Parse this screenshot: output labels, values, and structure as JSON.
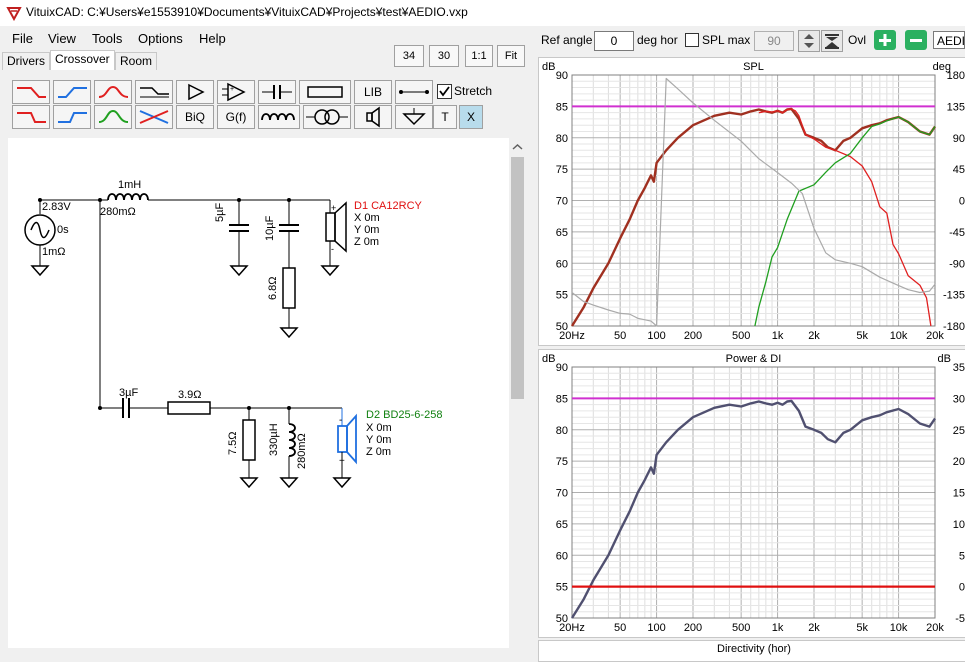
{
  "window": {
    "title": "VituixCAD: C:¥Users¥e1553910¥Documents¥VituixCAD¥Projects¥test¥AEDIO.vxp"
  },
  "menu": [
    "File",
    "View",
    "Tools",
    "Options",
    "Help"
  ],
  "tabs": [
    "Drivers",
    "Crossover",
    "Room"
  ],
  "zoom": {
    "w": "34",
    "h": "30",
    "one_to_one": "1:1",
    "fit": "Fit"
  },
  "tools": {
    "lib": "LIB",
    "biq": "BiQ",
    "gf": "G(f)",
    "stretch": "Stretch",
    "t": "T",
    "x": "X",
    "stretch_checked": true
  },
  "right_toolbar": {
    "ref_angle_label": "Ref angle",
    "ref_angle_value": "0",
    "deg_hor": "deg hor",
    "spl_max_label": "SPL max",
    "spl_max_value": "90",
    "ovl": "Ovl",
    "overlay_name": "AEDIO"
  },
  "schematic": {
    "source": {
      "voltage": "2.83V",
      "delay": "0s",
      "impedance": "1mΩ"
    },
    "l1": {
      "value": "1mH",
      "dcr": "280mΩ"
    },
    "c1": "5µF",
    "c2": "10µF",
    "r1": "6.8Ω",
    "c3": "3µF",
    "r2": "3.9Ω",
    "r3": "7.5Ω",
    "l2": {
      "value": "330µH",
      "dcr": "280mΩ"
    },
    "d1": {
      "name": "D1 CA12RCY",
      "x": "X 0m",
      "y": "Y 0m",
      "z": "Z 0m",
      "color": "#e01010"
    },
    "d2": {
      "name": "D2 BD25-6-258",
      "x": "X 0m",
      "y": "Y 0m",
      "z": "Z 0m",
      "color": "#108010"
    }
  },
  "spl_graph": {
    "title": "SPL",
    "left_unit": "dB",
    "right_unit": "deg",
    "y_ticks": [
      "90",
      "85",
      "80",
      "75",
      "70",
      "65",
      "60",
      "55",
      "50"
    ],
    "right_ticks": [
      "180",
      "135",
      "90",
      "45",
      "0",
      "-45",
      "-90",
      "-135",
      "-180"
    ],
    "x_ticks": [
      "20Hz",
      "50",
      "100",
      "200",
      "500",
      "1k",
      "2k",
      "5k",
      "10k",
      "20k"
    ]
  },
  "power_graph": {
    "title": "Power & DI",
    "left_unit": "dB",
    "right_unit": "dB",
    "y_ticks": [
      "90",
      "85",
      "80",
      "75",
      "70",
      "65",
      "60",
      "55",
      "50"
    ],
    "right_ticks": [
      "35",
      "30",
      "25",
      "20",
      "15",
      "10",
      "5",
      "0",
      "-5"
    ],
    "x_ticks": [
      "20Hz",
      "50",
      "100",
      "200",
      "500",
      "1k",
      "2k",
      "5k",
      "10k",
      "20k"
    ]
  },
  "bottom_graph_title": "Directivity (hor)",
  "chart_data": [
    {
      "type": "line",
      "title": "SPL",
      "x_scale": "log",
      "xlim": [
        20,
        20000
      ],
      "ylim": [
        50,
        90
      ],
      "y2lim": [
        -180,
        180
      ],
      "grid": true,
      "reference_line": 85,
      "series": [
        {
          "color": "#a03020",
          "x": [
            20,
            25,
            30,
            40,
            50,
            60,
            70,
            80,
            90,
            95,
            100,
            120,
            150,
            200,
            300,
            400,
            500,
            600,
            700,
            800,
            900,
            1000,
            1100,
            1200,
            1300,
            1500,
            1700,
            2000,
            2300,
            2600,
            3000,
            3500,
            4000,
            5000,
            6000,
            7000,
            8000,
            10000,
            12000,
            15000,
            18000,
            20000
          ],
          "y": [
            50,
            53,
            56,
            60,
            64,
            67,
            70,
            72,
            74,
            73,
            76,
            78,
            80,
            82,
            83.5,
            84,
            83.7,
            84.2,
            84.5,
            84.2,
            84,
            84.3,
            84,
            84.5,
            84.6,
            83,
            80.5,
            80,
            79.5,
            78.5,
            78,
            79.5,
            80,
            81.5,
            82,
            82.3,
            82.8,
            83.3,
            82.5,
            81,
            80.5,
            81.8
          ]
        },
        {
          "color": "#e02020",
          "x": [
            700,
            800,
            900,
            1000,
            1100,
            1200,
            1300,
            1400,
            1500,
            1700,
            2000,
            2500,
            3000,
            4000,
            5000,
            6000,
            7000,
            8000,
            9000,
            10000,
            12000,
            15000,
            17000,
            18500
          ],
          "y": [
            84,
            84.2,
            84.1,
            84.3,
            84,
            84.5,
            84.6,
            84.3,
            83.5,
            80.5,
            79.8,
            78.5,
            78,
            77,
            75.5,
            73,
            69,
            68,
            63,
            61.5,
            58,
            56.5,
            54.5,
            50
          ]
        },
        {
          "color": "#20a020",
          "x": [
            650,
            700,
            800,
            900,
            1000,
            1200,
            1500,
            2000,
            2500,
            3000,
            4000,
            5000,
            6000,
            7000,
            8000,
            10000,
            12000,
            15000,
            18000,
            20000
          ],
          "y": [
            50,
            53,
            57,
            61,
            62.5,
            67,
            71.5,
            72.5,
            74.5,
            76,
            77.5,
            80,
            81.8,
            82.2,
            82.7,
            83.3,
            82.5,
            81,
            80.5,
            81.8
          ]
        },
        {
          "color": "#aaaaaa",
          "axis": "y2",
          "x": [
            20,
            25,
            30,
            40,
            50,
            60,
            70,
            90,
            100,
            120,
            150,
            200,
            300,
            500,
            700,
            1000,
            1300,
            1600,
            2000,
            2500,
            3000,
            4000,
            5000,
            7000,
            10000,
            12000,
            15000,
            18000,
            20000
          ],
          "y": [
            -132,
            -145,
            -150,
            -157,
            -162,
            -163,
            -169,
            -173,
            -180,
            175,
            160,
            140,
            115,
            85,
            60,
            40,
            25,
            10,
            -40,
            -75,
            -85,
            -90,
            -95,
            -110,
            -122,
            -128,
            -132,
            -130,
            -120
          ]
        }
      ]
    },
    {
      "type": "line",
      "title": "Power & DI",
      "x_scale": "log",
      "xlim": [
        20,
        20000
      ],
      "ylim": [
        50,
        90
      ],
      "y2lim": [
        -5,
        35
      ],
      "grid": true,
      "reference_line": 85,
      "series": [
        {
          "color": "#505070",
          "x": [
            20,
            25,
            30,
            40,
            50,
            60,
            70,
            80,
            90,
            95,
            100,
            120,
            150,
            200,
            300,
            400,
            500,
            600,
            700,
            800,
            900,
            1000,
            1100,
            1200,
            1300,
            1500,
            1700,
            2000,
            2300,
            2600,
            3000,
            3500,
            4000,
            5000,
            6000,
            7000,
            8000,
            10000,
            12000,
            15000,
            18000,
            20000
          ],
          "y": [
            50,
            53,
            56,
            60,
            64,
            67,
            70,
            72,
            74,
            73,
            76,
            78,
            80,
            82,
            83.5,
            84,
            83.7,
            84.2,
            84.5,
            84.2,
            84,
            84.3,
            84,
            84.5,
            84.6,
            83,
            80.5,
            80,
            79.5,
            78.5,
            78,
            79.5,
            80,
            81.5,
            82,
            82.3,
            82.8,
            83.3,
            82.5,
            81,
            80.5,
            81.8
          ]
        },
        {
          "color": "#e01010",
          "axis": "y2",
          "x": [
            20,
            20000
          ],
          "y": [
            0,
            0
          ]
        }
      ]
    }
  ]
}
